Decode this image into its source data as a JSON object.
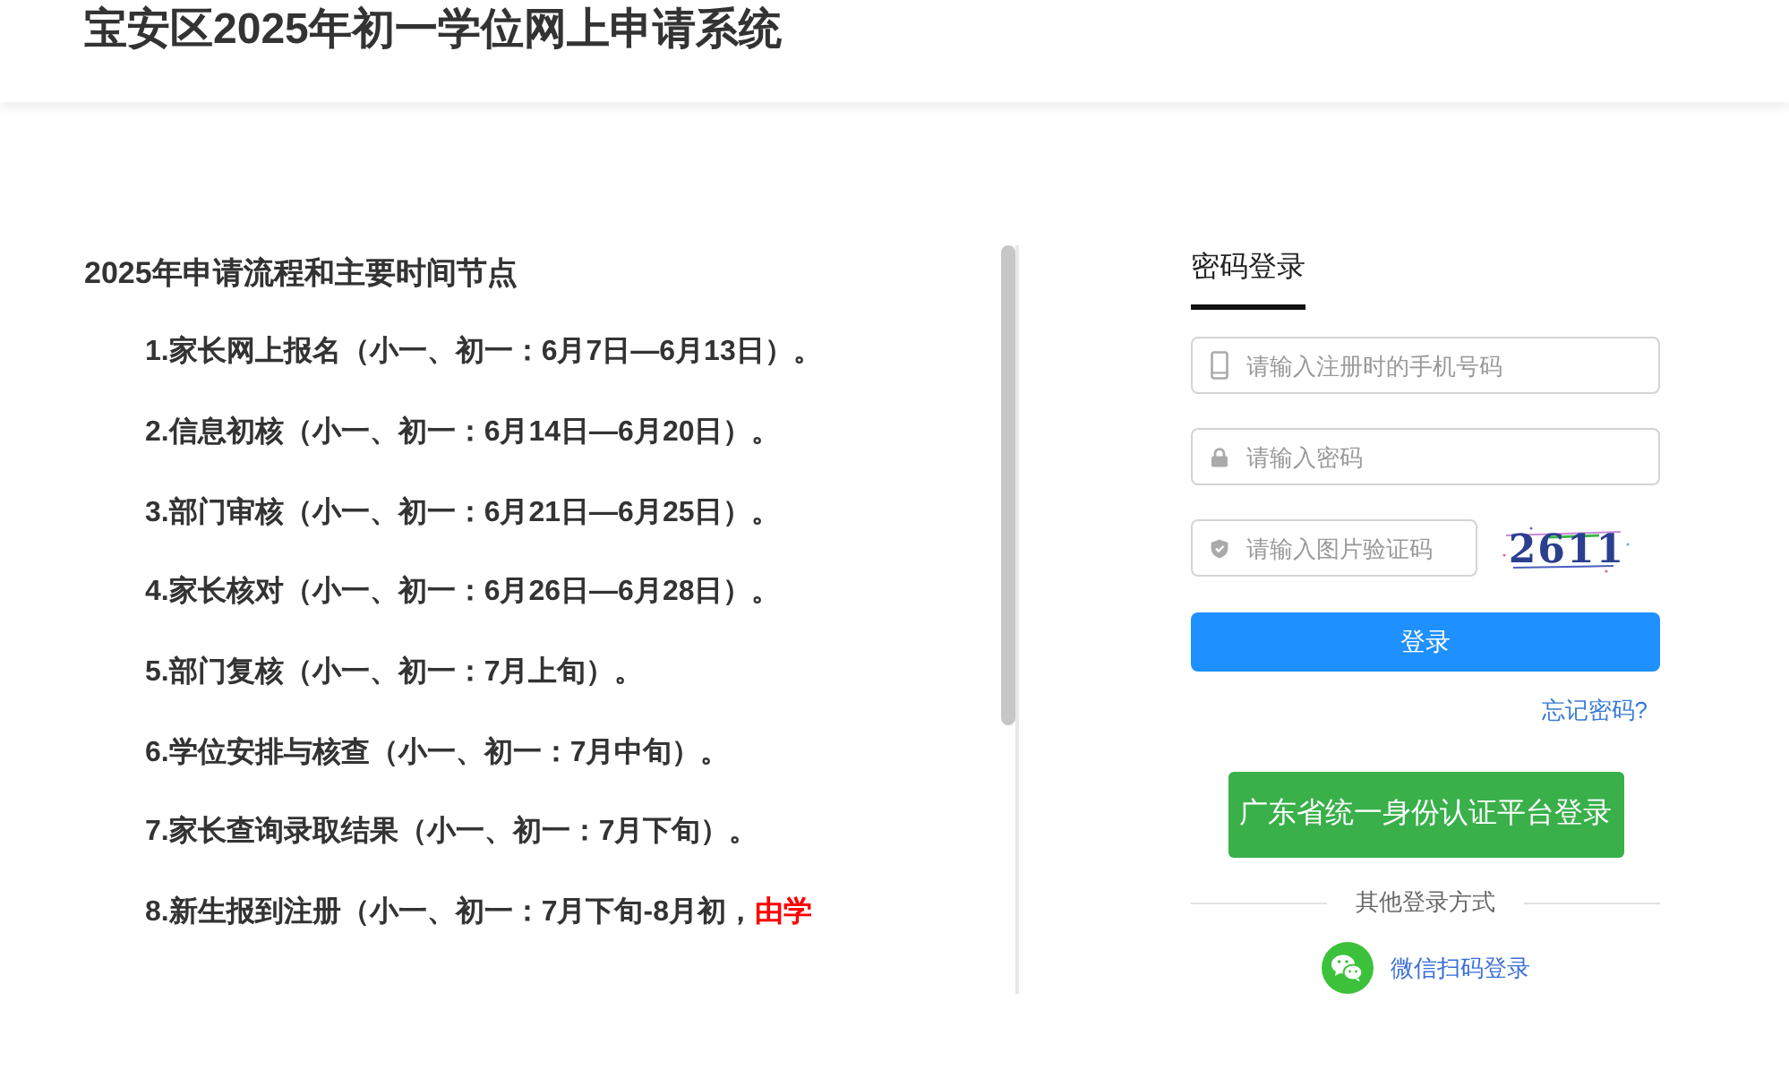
{
  "header": {
    "title": "宝安区2025年初一学位网上申请系统"
  },
  "schedule": {
    "heading": "2025年申请流程和主要时间节点",
    "items": [
      {
        "segments": [
          {
            "text": "1.家长网上报名（小一、初一：6月7日—6月13日）。",
            "emphasis": false
          }
        ]
      },
      {
        "segments": [
          {
            "text": "2.信息初核（小一、初一：6月14日—6月20日）。",
            "emphasis": false
          }
        ]
      },
      {
        "segments": [
          {
            "text": "3.部门审核（小一、初一：6月21日—6月25日）。",
            "emphasis": false
          }
        ]
      },
      {
        "segments": [
          {
            "text": "4.家长核对（小一、初一：6月26日—6月28日）。",
            "emphasis": false
          }
        ]
      },
      {
        "segments": [
          {
            "text": "5.部门复核（小一、初一：7月上旬）。",
            "emphasis": false
          }
        ]
      },
      {
        "segments": [
          {
            "text": "6.学位安排与核查（小一、初一：7月中旬）。",
            "emphasis": false
          }
        ]
      },
      {
        "segments": [
          {
            "text": "7.家长查询录取结果（小一、初一：7月下旬）。",
            "emphasis": false
          }
        ]
      },
      {
        "segments": [
          {
            "text": "8.新生报到注册（小一、初一：7月下旬-8月初，",
            "emphasis": false
          },
          {
            "text": "由学",
            "emphasis": true
          }
        ]
      }
    ]
  },
  "login": {
    "tabs": [
      {
        "label": "密码登录",
        "selected": true
      }
    ],
    "fields": [
      {
        "kind": "phone",
        "placeholder": "请输入注册时的手机号码"
      },
      {
        "kind": "password",
        "placeholder": "请输入密码"
      },
      {
        "kind": "captcha",
        "placeholder": "请输入图片验证码"
      }
    ],
    "captcha_image": {
      "code": "2611"
    },
    "login_button": "登录",
    "forgot_password": "忘记密码?",
    "unified_login_button": "广东省统一身份认证平台登录",
    "other_methods_label": "其他登录方式",
    "wechat_login": "微信扫码登录"
  }
}
